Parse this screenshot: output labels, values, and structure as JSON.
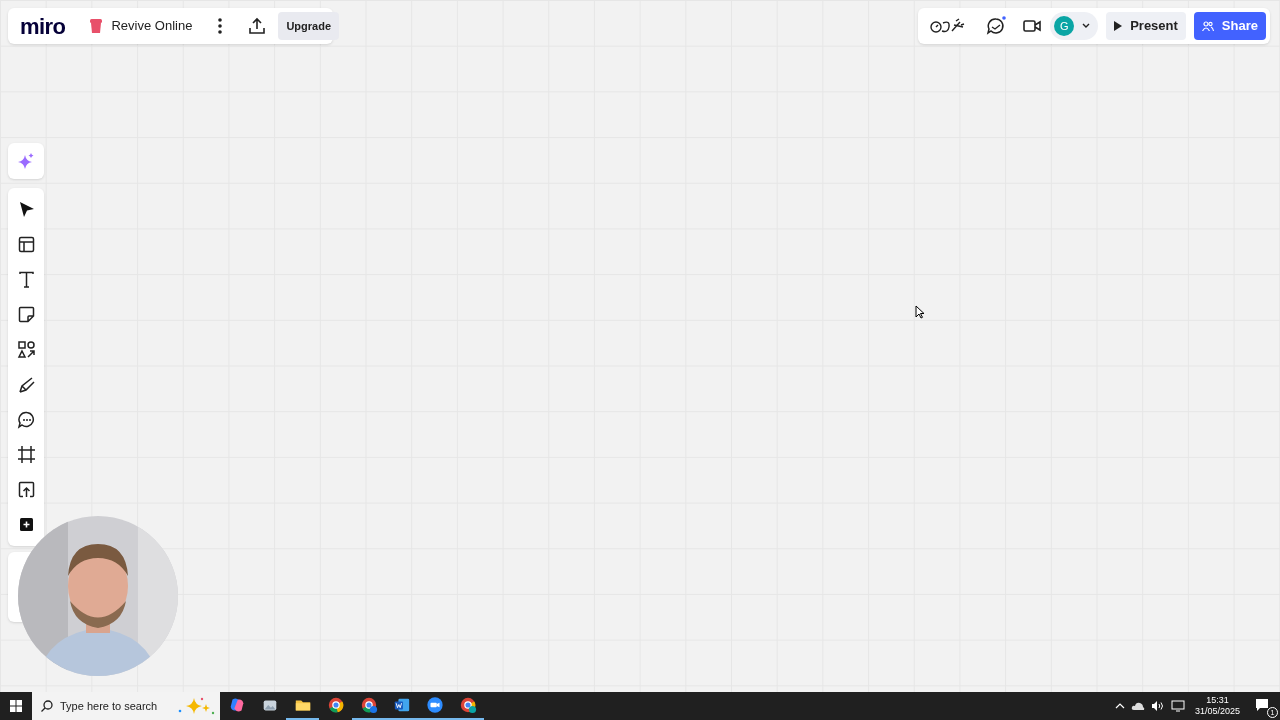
{
  "board": {
    "logo": "miro",
    "title": "Revive Online",
    "upgrade": "Upgrade"
  },
  "top_right": {
    "avatar": "G",
    "present": "Present",
    "share": "Share",
    "chat_unread": true
  },
  "tools": [
    {
      "kind": "select"
    },
    {
      "kind": "templates"
    },
    {
      "kind": "text"
    },
    {
      "kind": "sticky"
    },
    {
      "kind": "shapes"
    },
    {
      "kind": "pen"
    },
    {
      "kind": "comment"
    },
    {
      "kind": "frame"
    },
    {
      "kind": "upload"
    },
    {
      "kind": "more"
    }
  ],
  "taskbar": {
    "search_placeholder": "Type here to search",
    "apps": [
      {
        "kind": "copilot",
        "running": false
      },
      {
        "kind": "photos",
        "running": false
      },
      {
        "kind": "explorer",
        "running": true
      },
      {
        "kind": "chrome",
        "running": false
      },
      {
        "kind": "chrome-s",
        "running": true
      },
      {
        "kind": "word",
        "running": true
      },
      {
        "kind": "zoom",
        "running": true
      },
      {
        "kind": "chrome-g",
        "running": true
      }
    ],
    "time": "15:31",
    "date": "31/05/2025",
    "notifications": "1"
  }
}
